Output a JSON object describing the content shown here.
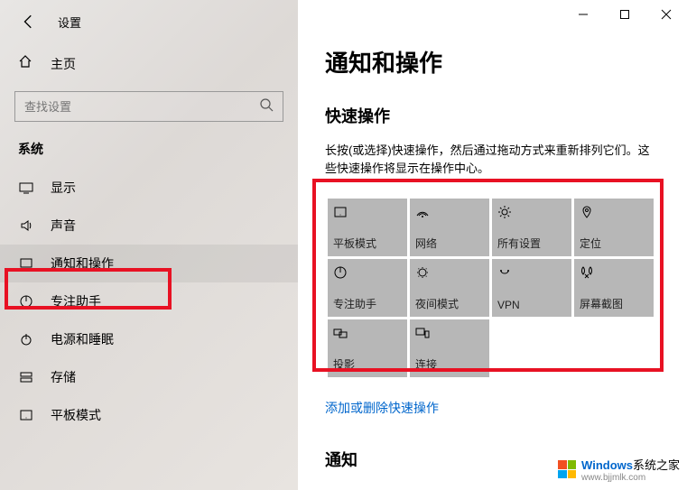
{
  "window": {
    "settings_label": "设置",
    "home_label": "主页",
    "search_placeholder": "查找设置",
    "section_label": "系统"
  },
  "nav": [
    {
      "icon": "display",
      "label": "显示"
    },
    {
      "icon": "sound",
      "label": "声音"
    },
    {
      "icon": "notif",
      "label": "通知和操作"
    },
    {
      "icon": "focus",
      "label": "专注助手"
    },
    {
      "icon": "power",
      "label": "电源和睡眠"
    },
    {
      "icon": "storage",
      "label": "存储"
    },
    {
      "icon": "tablet",
      "label": "平板模式"
    }
  ],
  "main": {
    "title": "通知和操作",
    "quick_actions_heading": "快速操作",
    "quick_actions_desc": "长按(或选择)快速操作，然后通过拖动方式来重新排列它们。这些快速操作将显示在操作中心。",
    "tiles": [
      {
        "icon": "tablet",
        "label": "平板模式"
      },
      {
        "icon": "network",
        "label": "网络"
      },
      {
        "icon": "allsettings",
        "label": "所有设置"
      },
      {
        "icon": "location",
        "label": "定位"
      },
      {
        "icon": "focus",
        "label": "专注助手"
      },
      {
        "icon": "night",
        "label": "夜间模式"
      },
      {
        "icon": "vpn",
        "label": "VPN"
      },
      {
        "icon": "snip",
        "label": "屏幕截图"
      },
      {
        "icon": "project",
        "label": "投影"
      },
      {
        "icon": "connect",
        "label": "连接"
      }
    ],
    "edit_link": "添加或删除快速操作",
    "notifications_heading": "通知"
  },
  "watermark": {
    "brand": "Windows",
    "brand2": "系统之家",
    "url": "www.bjjmlk.com"
  }
}
